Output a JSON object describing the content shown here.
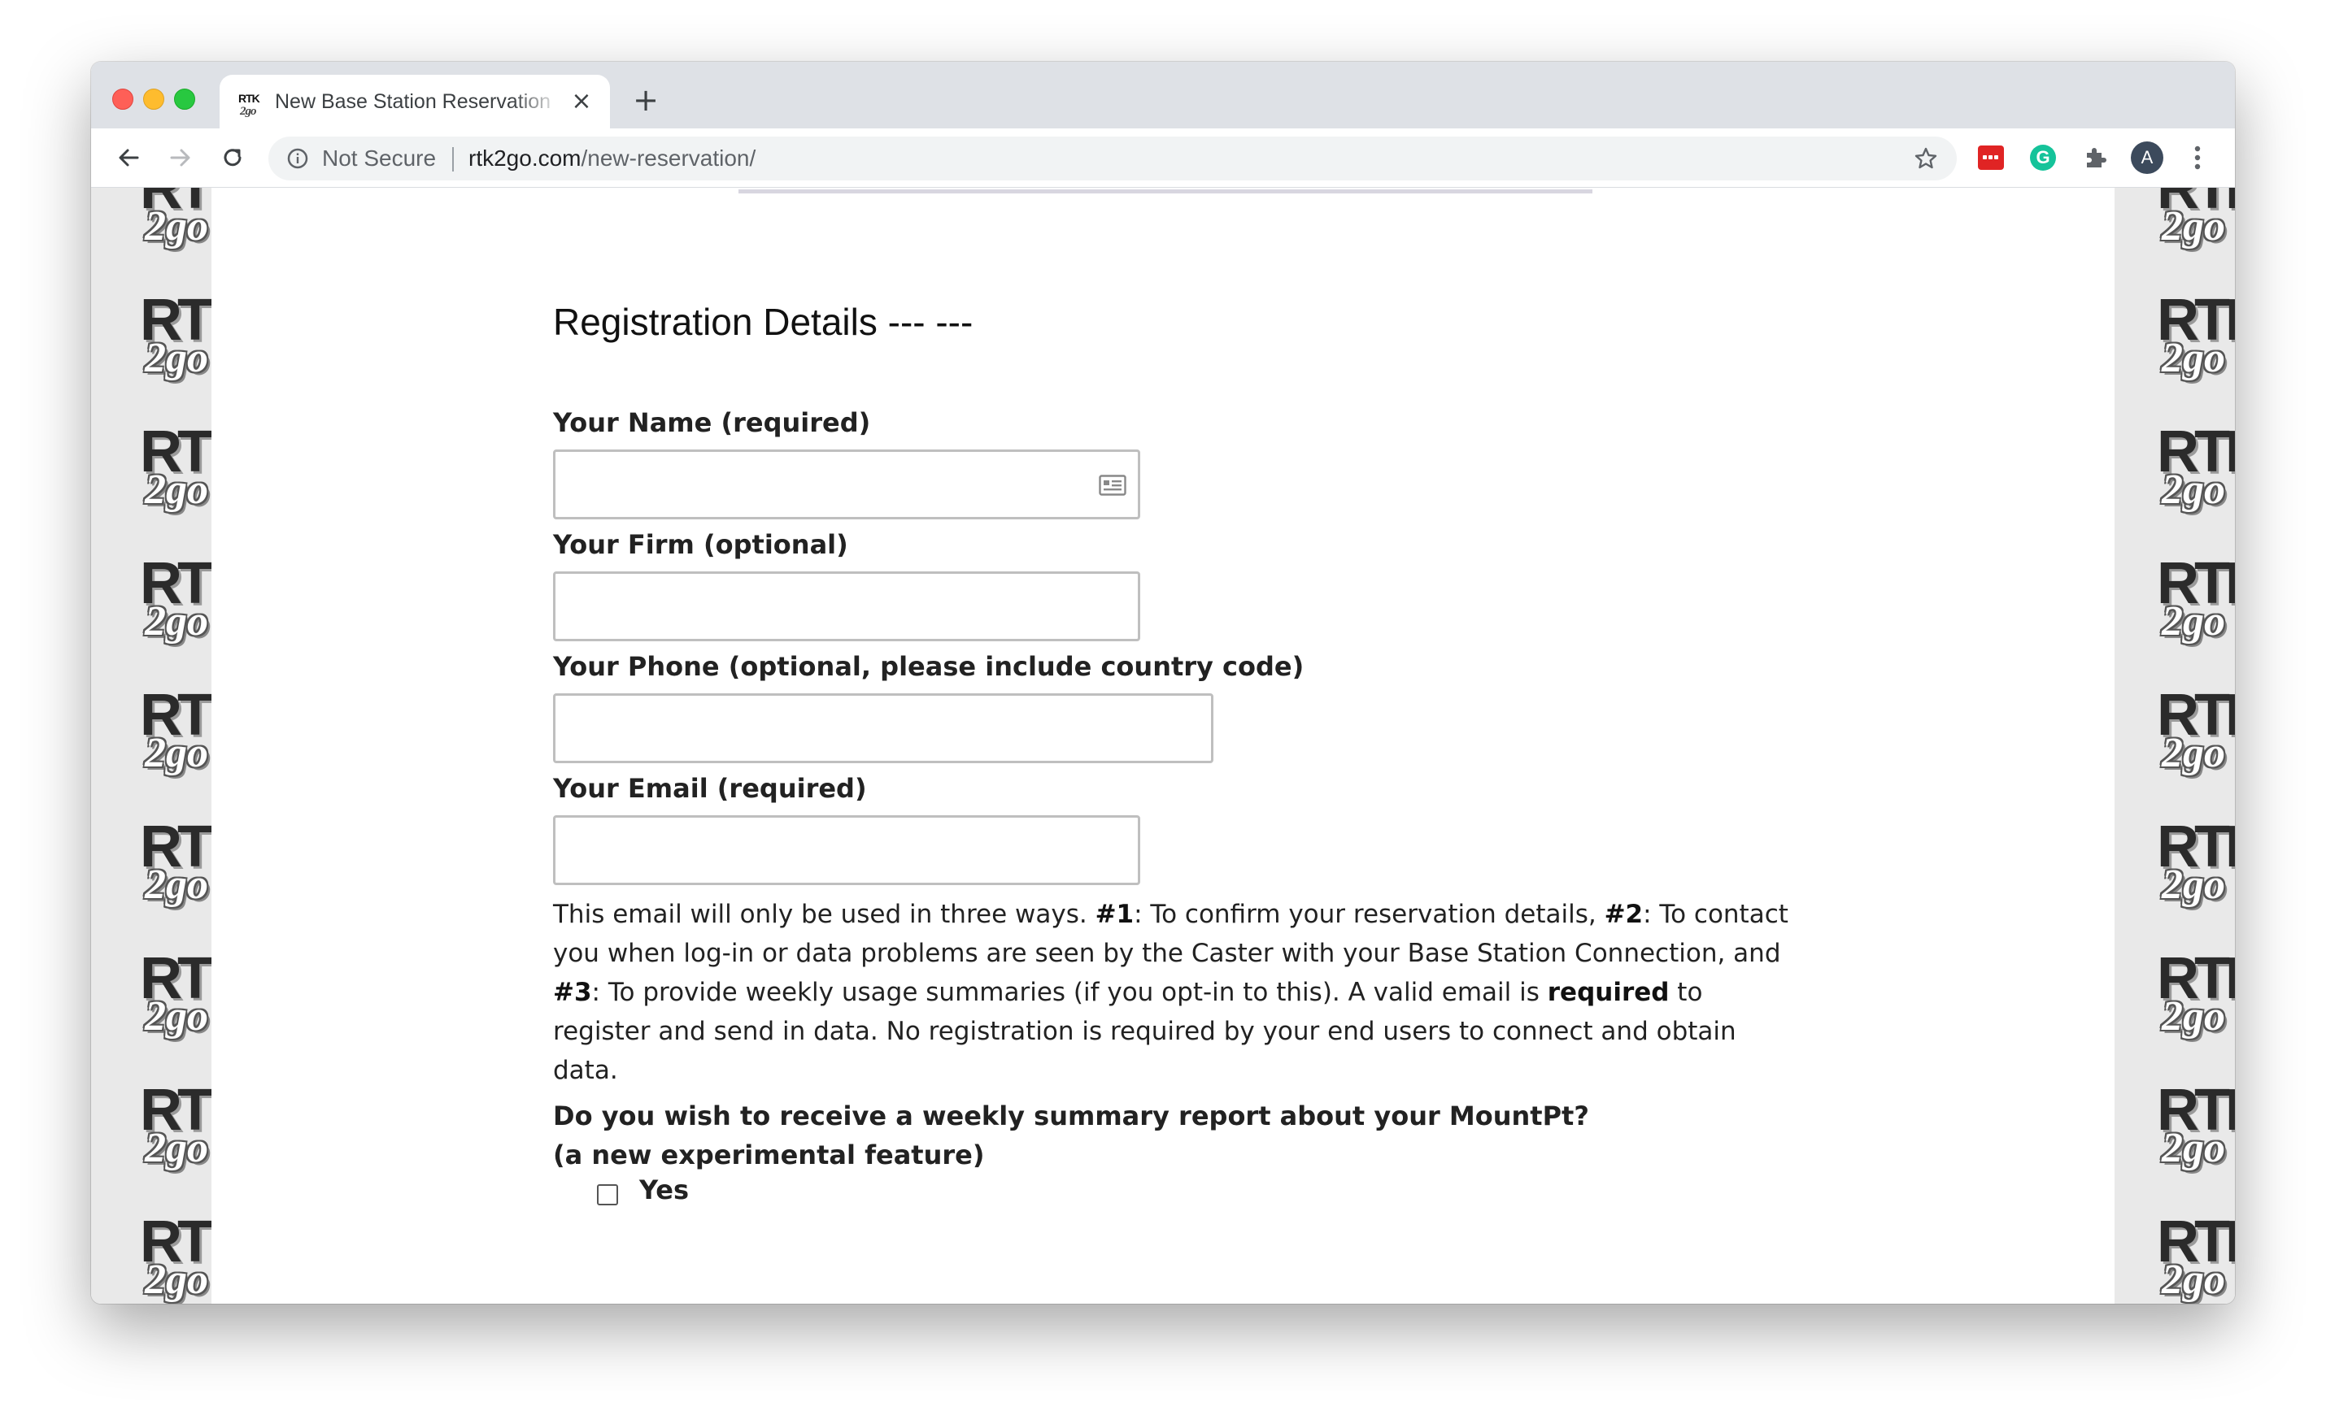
{
  "browser": {
    "tab": {
      "favicon_text": "RTK 2go",
      "title": "New Base Station Reservation",
      "close_glyph": "×"
    },
    "new_tab_glyph": "+",
    "security_label": "Not Secure",
    "url_host": "rtk2go.com",
    "url_path": "/new-reservation/",
    "avatar_initial": "A",
    "extension_letter": "G"
  },
  "background_logo": {
    "rtk": "RTK",
    "two_go": "2go"
  },
  "form": {
    "title": "Registration Details --- ---",
    "name_label": "Your Name (required)",
    "firm_label": "Your Firm (optional)",
    "phone_label": "Your Phone (optional, please include country code)",
    "email_label": "Your Email (required)",
    "name_value": "",
    "firm_value": "",
    "phone_value": "",
    "email_value": "",
    "help": {
      "p1": "This email will only be used in three ways. ",
      "b1": "#1",
      "p2": ": To confirm your reservation details, ",
      "b2": "#2",
      "p3": ": To contact you when log-in or data problems are seen by the Caster with your Base Station Connection, and ",
      "b3": "#3",
      "p4": ": To provide weekly usage summaries (if you opt-in to this). A valid email is ",
      "b4": "required",
      "p5": " to register and send in data. No registration is required by your end users to connect and obtain data."
    },
    "question_line1": "Do you wish to receive a weekly summary report about your MountPt?",
    "question_line2": "(a new experimental feature)",
    "checkbox_label": "Yes",
    "checkbox_checked": false
  },
  "colors": {
    "tabstrip": "#dee1e6",
    "omnibox": "#f1f3f4",
    "ext_red": "#e02424",
    "ext_green": "#15c39a",
    "avatar": "#3c4a5c"
  }
}
